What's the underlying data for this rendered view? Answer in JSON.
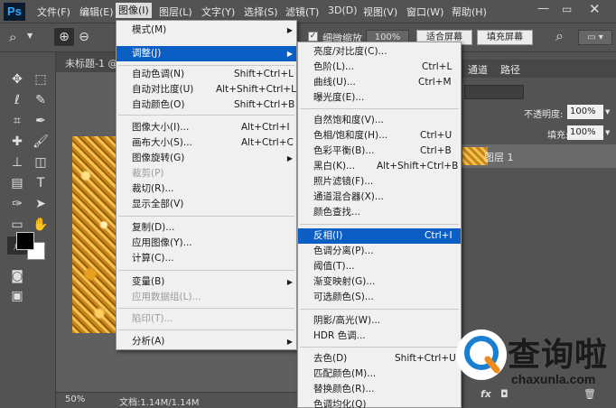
{
  "app": {
    "logo": "Ps"
  },
  "menubar": {
    "items": [
      "文件(F)",
      "编辑(E)",
      "图像(I)",
      "图层(L)",
      "文字(Y)",
      "选择(S)",
      "滤镜(T)",
      "3D(D)",
      "视图(V)",
      "窗口(W)",
      "帮助(H)"
    ]
  },
  "options": {
    "scrubby_label": "细微缩放",
    "zoom": "100%",
    "fit_label": "适合屏幕",
    "fill_label": "填充屏幕"
  },
  "document": {
    "tab_title": "未标题-1 @"
  },
  "status": {
    "zoom": "50%",
    "doc_info": "文档:1.14M/1.14M"
  },
  "image_menu": {
    "mode": "模式(M)",
    "adjust": "调整(J)",
    "auto_tone": "自动色调(N)",
    "auto_tone_sc": "Shift+Ctrl+L",
    "auto_contrast": "自动对比度(U)",
    "auto_contrast_sc": "Alt+Shift+Ctrl+L",
    "auto_color": "自动颜色(O)",
    "auto_color_sc": "Shift+Ctrl+B",
    "image_size": "图像大小(I)...",
    "image_size_sc": "Alt+Ctrl+I",
    "canvas_size": "画布大小(S)...",
    "canvas_size_sc": "Alt+Ctrl+C",
    "rotation": "图像旋转(G)",
    "crop": "裁剪(P)",
    "trim": "裁切(R)...",
    "reveal_all": "显示全部(V)",
    "duplicate": "复制(D)...",
    "apply_image": "应用图像(Y)...",
    "calculations": "计算(C)...",
    "variables": "变量(B)",
    "apply_dataset": "应用数据组(L)...",
    "trap": "陷印(T)...",
    "analysis": "分析(A)"
  },
  "adjust_menu": {
    "brightness": "亮度/对比度(C)...",
    "levels": "色阶(L)...",
    "levels_sc": "Ctrl+L",
    "curves": "曲线(U)...",
    "curves_sc": "Ctrl+M",
    "exposure": "曝光度(E)...",
    "vibrance": "自然饱和度(V)...",
    "hue_sat": "色相/饱和度(H)...",
    "hue_sat_sc": "Ctrl+U",
    "color_balance": "色彩平衡(B)...",
    "color_balance_sc": "Ctrl+B",
    "bw": "黑白(K)...",
    "bw_sc": "Alt+Shift+Ctrl+B",
    "photo_filter": "照片滤镜(F)...",
    "channel_mixer": "通道混合器(X)...",
    "color_lookup": "颜色查找...",
    "invert": "反相(I)",
    "invert_sc": "Ctrl+I",
    "posterize": "色调分离(P)...",
    "threshold": "阈值(T)...",
    "gradient_map": "渐变映射(G)...",
    "selective_color": "可选颜色(S)...",
    "shadows": "阴影/高光(W)...",
    "hdr": "HDR 色调...",
    "desaturate": "去色(D)",
    "desaturate_sc": "Shift+Ctrl+U",
    "match_color": "匹配颜色(M)...",
    "replace_color": "替换颜色(R)...",
    "equalize": "色调均化(Q)"
  },
  "panels": {
    "tab_channels": "通道",
    "tab_paths": "路径",
    "opacity_label": "不透明度:",
    "opacity_value": "100%",
    "fill_label": "填充:",
    "fill_value": "100%",
    "layer_name": "图层 1"
  },
  "watermark": {
    "brand": "查询啦",
    "url": "chaxunla.com"
  },
  "colors": {
    "highlight": "#0b5fc4",
    "ui_bg": "#535353",
    "watermark_blue": "#1a7fd1",
    "watermark_orange": "#f08a1c"
  }
}
